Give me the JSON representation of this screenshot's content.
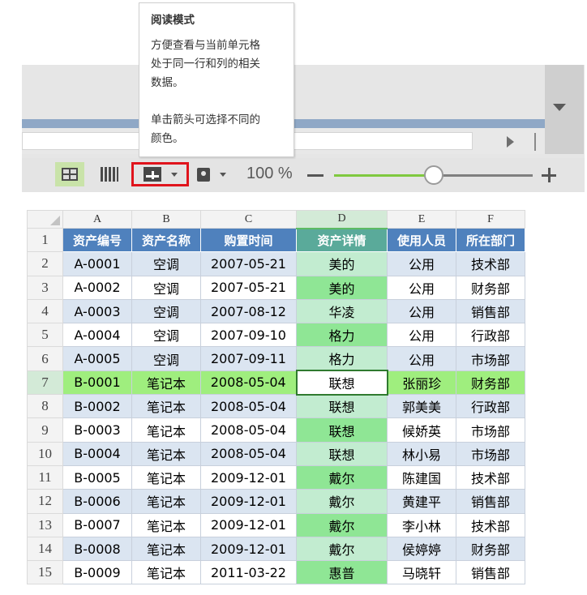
{
  "tooltip": {
    "title": "阅读模式",
    "line1": "方便查看与当前单元格",
    "line2": "处于同一行和列的相关",
    "line3": "数据。",
    "line4": "单击箭头可选择不同的",
    "line5": "颜色。"
  },
  "statusbar": {
    "zoom_label": "100 %",
    "zoom_percent": 100,
    "zoom_slider_fraction": 0.5,
    "icons": [
      "normal-view-icon",
      "page-break-view-icon",
      "reading-mode-icon",
      "protect-view-icon"
    ]
  },
  "colors": {
    "reading_row": "#9fee7e",
    "reading_col": "#8fe695",
    "header_fill": "#4f81bd",
    "highlight_box": "#e0141c"
  },
  "sheet": {
    "columns": [
      "A",
      "B",
      "C",
      "D",
      "E",
      "F"
    ],
    "headers": [
      "资产编号",
      "资产名称",
      "购置时间",
      "资产详情",
      "使用人员",
      "所在部门"
    ],
    "rows": [
      {
        "num": "1"
      },
      {
        "num": "2",
        "cells": [
          "A-0001",
          "空调",
          "2007-05-21",
          "美的",
          "公用",
          "技术部"
        ]
      },
      {
        "num": "3",
        "cells": [
          "A-0002",
          "空调",
          "2007-05-21",
          "美的",
          "公用",
          "财务部"
        ]
      },
      {
        "num": "4",
        "cells": [
          "A-0003",
          "空调",
          "2007-08-12",
          "华凌",
          "公用",
          "销售部"
        ]
      },
      {
        "num": "5",
        "cells": [
          "A-0004",
          "空调",
          "2007-09-10",
          "格力",
          "公用",
          "行政部"
        ]
      },
      {
        "num": "6",
        "cells": [
          "A-0005",
          "空调",
          "2007-09-11",
          "格力",
          "公用",
          "市场部"
        ]
      },
      {
        "num": "7",
        "cells": [
          "B-0001",
          "笔记本",
          "2008-05-04",
          "联想",
          "张丽珍",
          "财务部"
        ]
      },
      {
        "num": "8",
        "cells": [
          "B-0002",
          "笔记本",
          "2008-05-04",
          "联想",
          "郭美美",
          "行政部"
        ]
      },
      {
        "num": "9",
        "cells": [
          "B-0003",
          "笔记本",
          "2008-05-04",
          "联想",
          "候娇英",
          "市场部"
        ]
      },
      {
        "num": "10",
        "cells": [
          "B-0004",
          "笔记本",
          "2008-05-04",
          "联想",
          "林小易",
          "市场部"
        ]
      },
      {
        "num": "11",
        "cells": [
          "B-0005",
          "笔记本",
          "2009-12-01",
          "戴尔",
          "陈建国",
          "技术部"
        ]
      },
      {
        "num": "12",
        "cells": [
          "B-0006",
          "笔记本",
          "2009-12-01",
          "戴尔",
          "黄建平",
          "销售部"
        ]
      },
      {
        "num": "13",
        "cells": [
          "B-0007",
          "笔记本",
          "2009-12-01",
          "戴尔",
          "李小林",
          "技术部"
        ]
      },
      {
        "num": "14",
        "cells": [
          "B-0008",
          "笔记本",
          "2009-12-01",
          "戴尔",
          "侯婷婷",
          "财务部"
        ]
      },
      {
        "num": "15",
        "cells": [
          "B-0009",
          "笔记本",
          "2011-03-22",
          "惠普",
          "马晓轩",
          "销售部"
        ]
      }
    ]
  }
}
